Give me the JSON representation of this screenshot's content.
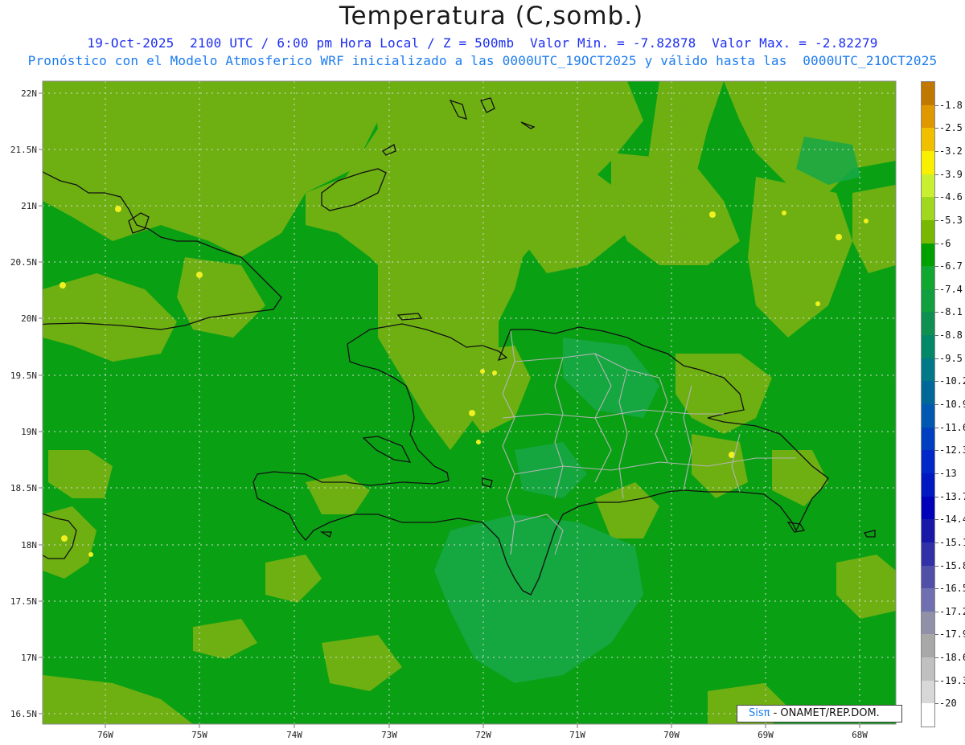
{
  "header": {
    "title": "Temperatura (C,somb.)",
    "line1": "19-Oct-2025  2100 UTC / 6:00 pm Hora Local / Z = 500mb  Valor Min. = -7.82878  Valor Max. = -2.82279",
    "line2": "Pronóstico con el Modelo Atmosferico WRF inicializado a las 0000UTC_19OCT2025 y válido hasta las  0000UTC_21OCT2025"
  },
  "map": {
    "lat_labels": [
      "22N",
      "21.5N",
      "21N",
      "20.5N",
      "20N",
      "19.5N",
      "19N",
      "18.5N",
      "18N",
      "17.5N",
      "17N",
      "16.5N"
    ],
    "lon_labels": [
      "76W",
      "75W",
      "74W",
      "73W",
      "72W",
      "71W",
      "70W",
      "69W",
      "68W"
    ]
  },
  "colorbar": {
    "labels": [
      "-1.8",
      "-2.5",
      "-3.2",
      "-3.9",
      "-4.6",
      "-5.3",
      "-6",
      "-6.7",
      "-7.4",
      "-8.1",
      "-8.8",
      "-9.5",
      "-10.2",
      "-10.9",
      "-11.6",
      "-12.3",
      "-13",
      "-13.7",
      "-14.4",
      "-15.1",
      "-15.8",
      "-16.5",
      "-17.2",
      "-17.9",
      "-18.6",
      "-19.3",
      "-20"
    ],
    "colors": [
      "#c07800",
      "#e09800",
      "#f0c000",
      "#f8f000",
      "#c8f030",
      "#a0d820",
      "#78b800",
      "#00a000",
      "#10a830",
      "#10a040",
      "#109050",
      "#008868",
      "#007888",
      "#006898",
      "#0058b0",
      "#0040c0",
      "#0028c8",
      "#0018c0",
      "#0000b8",
      "#1818a8",
      "#3030a8",
      "#5050a8",
      "#7070b0",
      "#9090a8",
      "#a8a8a8",
      "#c0c0c0",
      "#d8d8d8",
      "#ffffff"
    ]
  },
  "credit": {
    "brand": "Sisπ",
    "text": "- ONAMET/REP.DOM."
  }
}
